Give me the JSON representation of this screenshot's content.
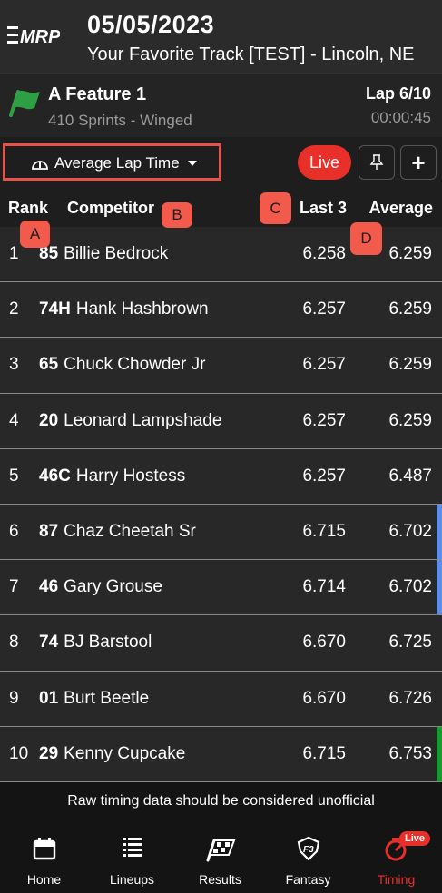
{
  "header": {
    "logo_text": "MRP",
    "date": "05/05/2023",
    "track": "Your Favorite Track [TEST] - Lincoln, NE"
  },
  "race": {
    "name": "A Feature 1",
    "class": "410 Sprints - Winged",
    "lap": "Lap 6/10",
    "elapsed": "00:00:45"
  },
  "controls": {
    "sort_label": "Average Lap Time",
    "live_label": "Live"
  },
  "columns": {
    "rank": "Rank",
    "competitor": "Competitor",
    "last3": "Last 3",
    "average": "Average"
  },
  "annotations": {
    "a": "A",
    "b": "B",
    "c": "C",
    "d": "D"
  },
  "rows": [
    {
      "rank": "1",
      "car": "85",
      "name": "Billie Bedrock",
      "last3": "6.258",
      "avg": "6.259",
      "bar": ""
    },
    {
      "rank": "2",
      "car": "74H",
      "name": "Hank Hashbrown",
      "last3": "6.257",
      "avg": "6.259",
      "bar": ""
    },
    {
      "rank": "3",
      "car": "65",
      "name": "Chuck Chowder Jr",
      "last3": "6.257",
      "avg": "6.259",
      "bar": ""
    },
    {
      "rank": "4",
      "car": "20",
      "name": "Leonard Lampshade",
      "last3": "6.257",
      "avg": "6.259",
      "bar": ""
    },
    {
      "rank": "5",
      "car": "46C",
      "name": "Harry Hostess",
      "last3": "6.257",
      "avg": "6.487",
      "bar": ""
    },
    {
      "rank": "6",
      "car": "87",
      "name": "Chaz Cheetah Sr",
      "last3": "6.715",
      "avg": "6.702",
      "bar": "#5b8ee6"
    },
    {
      "rank": "7",
      "car": "46",
      "name": "Gary Grouse",
      "last3": "6.714",
      "avg": "6.702",
      "bar": "#5b8ee6"
    },
    {
      "rank": "8",
      "car": "74",
      "name": "BJ Barstool",
      "last3": "6.670",
      "avg": "6.725",
      "bar": ""
    },
    {
      "rank": "9",
      "car": "01",
      "name": "Burt Beetle",
      "last3": "6.670",
      "avg": "6.726",
      "bar": ""
    },
    {
      "rank": "10",
      "car": "29",
      "name": "Kenny Cupcake",
      "last3": "6.715",
      "avg": "6.753",
      "bar": "#1a9a2e"
    }
  ],
  "disclaimer": "Raw timing data should be considered unofficial",
  "nav": {
    "home": "Home",
    "lineups": "Lineups",
    "results": "Results",
    "fantasy": "Fantasy",
    "timing": "Timing",
    "live_badge": "Live"
  },
  "colors": {
    "accent_red": "#e8302a",
    "flag_green": "#2ea043",
    "badge_orange": "#f25a4c"
  }
}
